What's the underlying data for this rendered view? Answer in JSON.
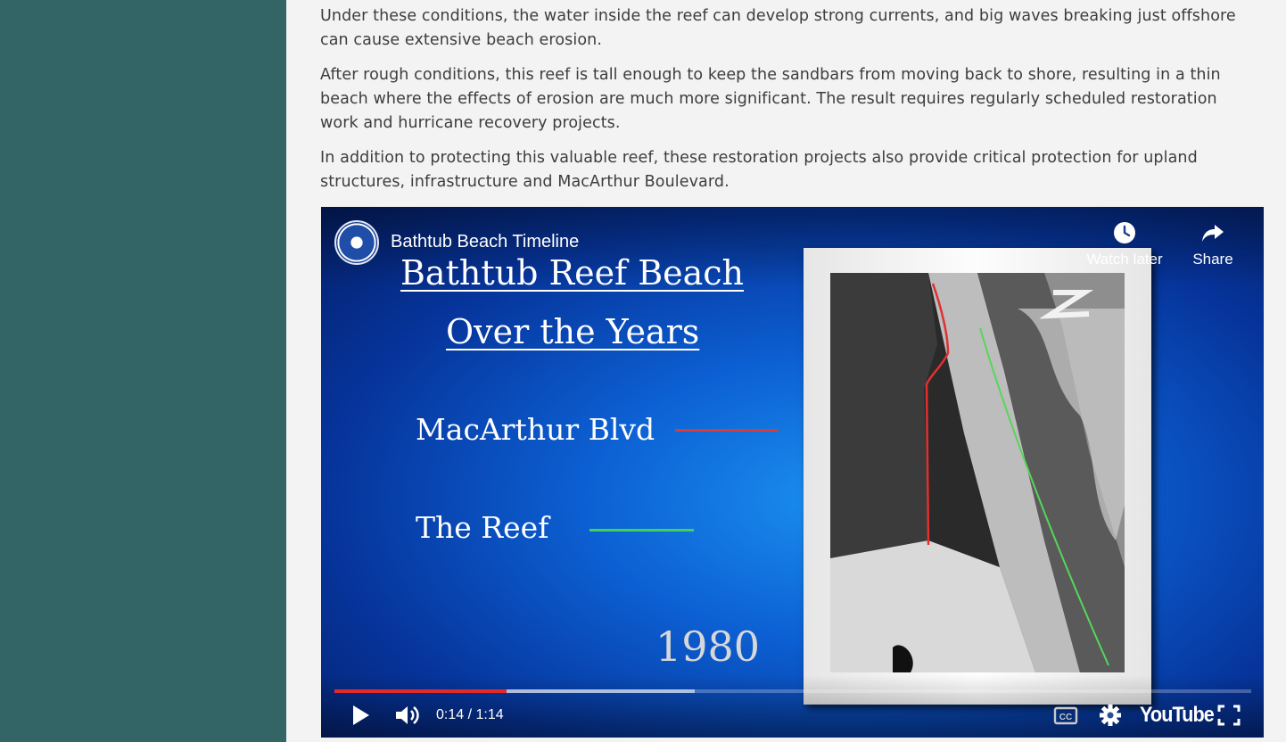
{
  "article": {
    "paragraphs": [
      "Under these conditions, the water inside the reef can develop strong currents, and big waves breaking just offshore can cause extensive beach erosion.",
      "After rough conditions, this reef is tall enough to keep the sandbars from moving back to shore, resulting in a thin beach where the effects of erosion are much more significant. The result requires regularly scheduled restoration work and hurricane recovery projects.",
      "In addition to protecting this valuable reef, these restoration projects also provide critical protection for upland structures, infrastructure and MacArthur Boulevard."
    ]
  },
  "video": {
    "title": "Bathtub Beach Timeline",
    "watch_later_label": "Watch later",
    "share_label": "Share",
    "slide": {
      "title_line1": "Bathtub Reef Beach",
      "title_line2": "Over the Years",
      "legend": [
        {
          "label": "MacArthur Blvd",
          "color": "#d93a3a"
        },
        {
          "label": "The Reef",
          "color": "#3fd25a"
        }
      ],
      "year": "1980"
    },
    "time_display": "0:14 / 1:14",
    "progress_played_fraction": 0.188,
    "progress_buffered_fraction": 0.393,
    "brand": "YouTube",
    "icons": [
      "clock-icon",
      "share-arrow-icon",
      "play-icon",
      "volume-icon",
      "cc-icon",
      "gear-icon",
      "fullscreen-icon"
    ],
    "accent_color": "#e32a2a"
  },
  "colors": {
    "sidebar": "#336466",
    "background": "#f3f3f3",
    "text": "#3d3d3d"
  }
}
